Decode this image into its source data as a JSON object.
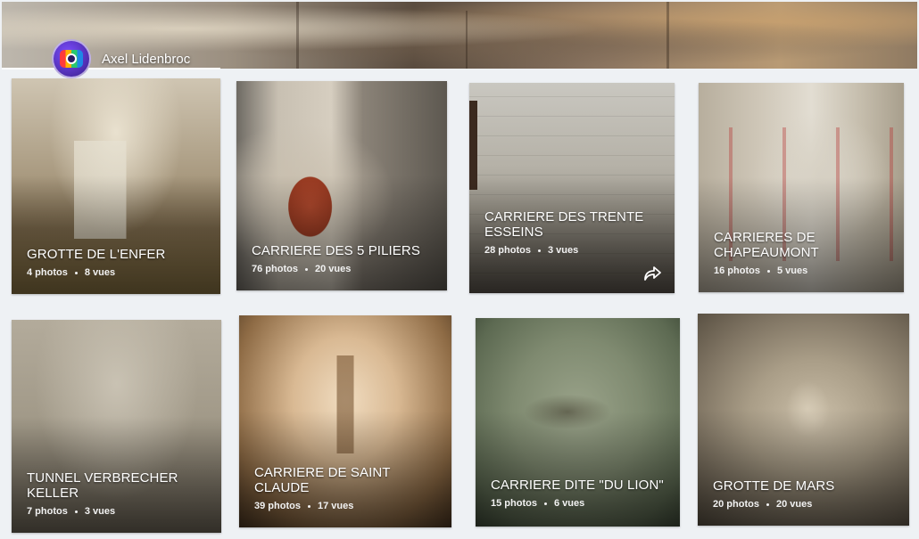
{
  "owner": {
    "name": "Axel Lidenbroc"
  },
  "albums": [
    {
      "title": "GROTTE DE L'ENFER",
      "photos": "4 photos",
      "views": "8 vues"
    },
    {
      "title": "CARRIERE DES 5 PILIERS",
      "photos": "76 photos",
      "views": "20 vues"
    },
    {
      "title": "CARRIERE DES TRENTE ESSEINS",
      "photos": "28 photos",
      "views": "3 vues",
      "share_icon": "share-arrow-icon"
    },
    {
      "title": "CARRIERES DE CHAPEAUMONT",
      "photos": "16 photos",
      "views": "5 vues"
    },
    {
      "title": "TUNNEL VERBRECHER KELLER",
      "photos": "7 photos",
      "views": "3 vues"
    },
    {
      "title": "CARRIERE DE SAINT CLAUDE",
      "photos": "39 photos",
      "views": "17 vues"
    },
    {
      "title": "CARRIERE dite \"DU LION\"",
      "photos": "15 photos",
      "views": "6 vues"
    },
    {
      "title": "GROTTE DE MARS",
      "photos": "20 photos",
      "views": "20 vues"
    }
  ]
}
